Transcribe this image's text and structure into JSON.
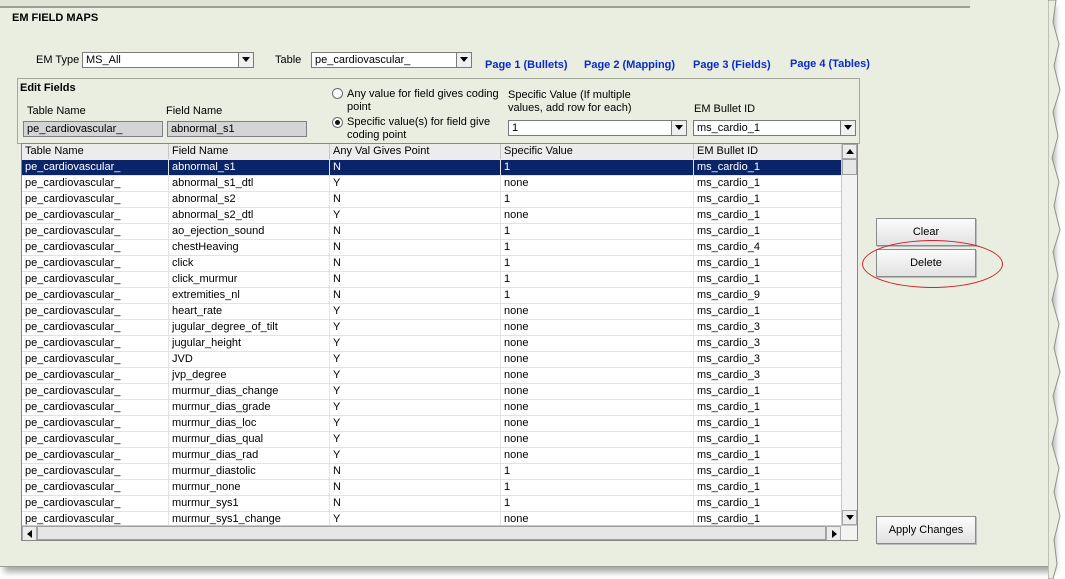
{
  "window": {
    "title": "EM FIELD MAPS"
  },
  "em_type": {
    "label": "EM Type",
    "value": "MS_All"
  },
  "table_select": {
    "label": "Table",
    "value": "pe_cardiovascular_"
  },
  "pages": [
    {
      "label": "Page 1 (Bullets)"
    },
    {
      "label": "Page 2 (Mapping)"
    },
    {
      "label": "Page 3 (Fields)"
    },
    {
      "label": "Page 4 (Tables)"
    }
  ],
  "edit_fields": {
    "title": "Edit Fields",
    "table_name_label": "Table Name",
    "table_name_value": "pe_cardiovascular_",
    "field_name_label": "Field Name",
    "field_name_value": "abnormal_s1",
    "radio_any_label": "Any value for field gives coding point",
    "radio_specific_label": "Specific value(s) for field give coding point",
    "radio_selected": "specific",
    "specific_value_label": "Specific Value (If multiple values, add row for each)",
    "specific_value_value": "1",
    "bullet_id_label": "EM Bullet ID",
    "bullet_id_value": "ms_cardio_1"
  },
  "grid": {
    "columns": [
      "Table Name",
      "Field Name",
      "Any Val Gives Point",
      "Specific Value",
      "EM Bullet ID"
    ],
    "selected_row": 0,
    "rows": [
      [
        "pe_cardiovascular_",
        "abnormal_s1",
        "N",
        "1",
        "ms_cardio_1"
      ],
      [
        "pe_cardiovascular_",
        "abnormal_s1_dtl",
        "Y",
        "none",
        "ms_cardio_1"
      ],
      [
        "pe_cardiovascular_",
        "abnormal_s2",
        "N",
        "1",
        "ms_cardio_1"
      ],
      [
        "pe_cardiovascular_",
        "abnormal_s2_dtl",
        "Y",
        "none",
        "ms_cardio_1"
      ],
      [
        "pe_cardiovascular_",
        "ao_ejection_sound",
        "N",
        "1",
        "ms_cardio_1"
      ],
      [
        "pe_cardiovascular_",
        "chestHeaving",
        "N",
        "1",
        "ms_cardio_4"
      ],
      [
        "pe_cardiovascular_",
        "click",
        "N",
        "1",
        "ms_cardio_1"
      ],
      [
        "pe_cardiovascular_",
        "click_murmur",
        "N",
        "1",
        "ms_cardio_1"
      ],
      [
        "pe_cardiovascular_",
        "extremities_nl",
        "N",
        "1",
        "ms_cardio_9"
      ],
      [
        "pe_cardiovascular_",
        "heart_rate",
        "Y",
        "none",
        "ms_cardio_1"
      ],
      [
        "pe_cardiovascular_",
        "jugular_degree_of_tilt",
        "Y",
        "none",
        "ms_cardio_3"
      ],
      [
        "pe_cardiovascular_",
        "jugular_height",
        "Y",
        "none",
        "ms_cardio_3"
      ],
      [
        "pe_cardiovascular_",
        "JVD",
        "Y",
        "none",
        "ms_cardio_3"
      ],
      [
        "pe_cardiovascular_",
        "jvp_degree",
        "Y",
        "none",
        "ms_cardio_3"
      ],
      [
        "pe_cardiovascular_",
        "murmur_dias_change",
        "Y",
        "none",
        "ms_cardio_1"
      ],
      [
        "pe_cardiovascular_",
        "murmur_dias_grade",
        "Y",
        "none",
        "ms_cardio_1"
      ],
      [
        "pe_cardiovascular_",
        "murmur_dias_loc",
        "Y",
        "none",
        "ms_cardio_1"
      ],
      [
        "pe_cardiovascular_",
        "murmur_dias_qual",
        "Y",
        "none",
        "ms_cardio_1"
      ],
      [
        "pe_cardiovascular_",
        "murmur_dias_rad",
        "Y",
        "none",
        "ms_cardio_1"
      ],
      [
        "pe_cardiovascular_",
        "murmur_diastolic",
        "N",
        "1",
        "ms_cardio_1"
      ],
      [
        "pe_cardiovascular_",
        "murmur_none",
        "N",
        "1",
        "ms_cardio_1"
      ],
      [
        "pe_cardiovascular_",
        "murmur_sys1",
        "N",
        "1",
        "ms_cardio_1"
      ],
      [
        "pe_cardiovascular_",
        "murmur_sys1_change",
        "Y",
        "none",
        "ms_cardio_1"
      ]
    ]
  },
  "buttons": {
    "clear": "Clear",
    "delete": "Delete",
    "apply": "Apply Changes"
  },
  "colors": {
    "link": "#0a2bc9",
    "selection": "#0a246a",
    "highlight_ellipse": "#c9242a",
    "panel": "#e9eee1"
  }
}
